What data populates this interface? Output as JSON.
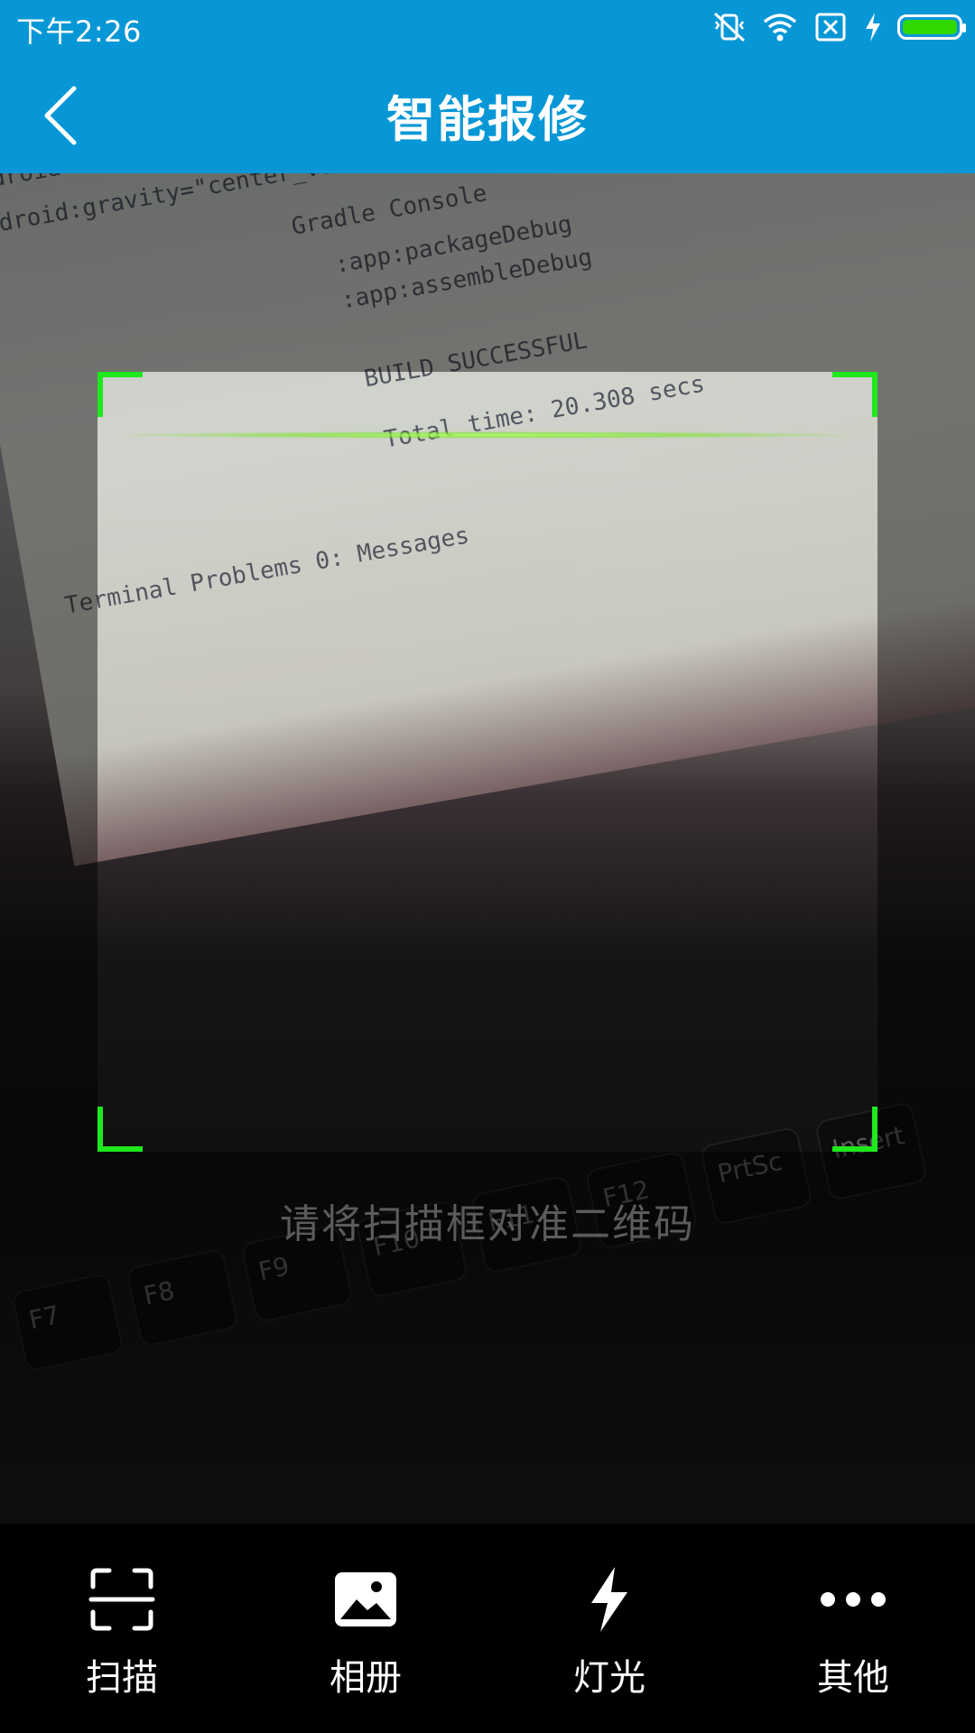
{
  "status_bar": {
    "time": "下午2:26",
    "icons": [
      "vibrate-off-icon",
      "wifi-icon",
      "sim-off-icon",
      "charging-icon",
      "battery-icon"
    ],
    "battery_color": "#31d800"
  },
  "header": {
    "title": "智能报修",
    "back_icon": "chevron-left-icon",
    "background_color": "#0797d6"
  },
  "camera_view": {
    "scan_frame_color": "#1ee81e",
    "hint": "请将扫描框对准二维码"
  },
  "toolbar": {
    "items": [
      {
        "label": "扫描",
        "icon": "scan-icon"
      },
      {
        "label": "相册",
        "icon": "gallery-icon"
      },
      {
        "label": "灯光",
        "icon": "flash-icon"
      },
      {
        "label": "其他",
        "icon": "more-icon"
      }
    ]
  }
}
